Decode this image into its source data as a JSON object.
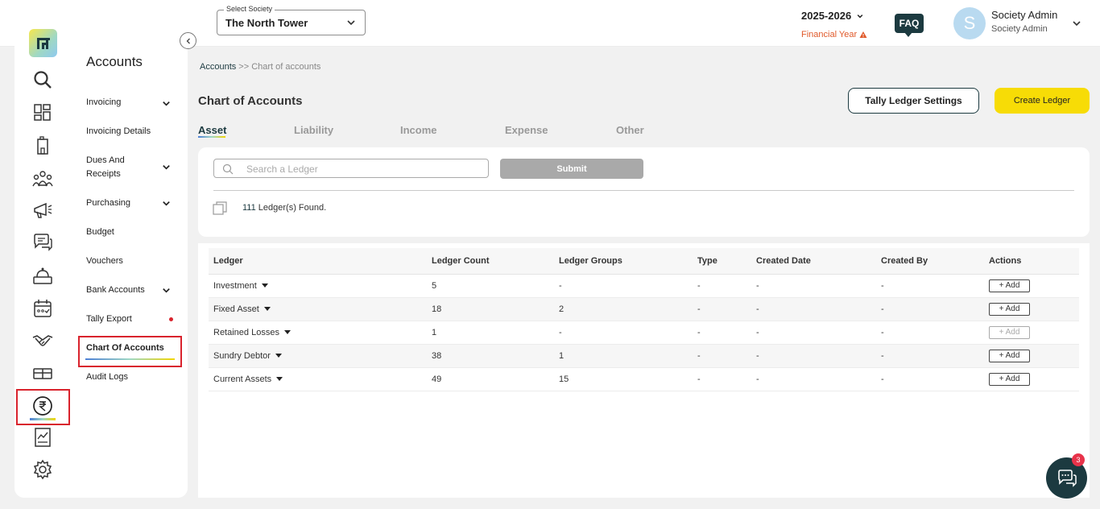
{
  "header": {
    "society_label": "Select Society",
    "society_value": "The North Tower",
    "financial_year": "2025-2026",
    "financial_year_label": "Financial Year",
    "faq_label": "FAQ",
    "avatar_initial": "S",
    "user_name": "Society Admin",
    "user_role": "Society Admin"
  },
  "sidebar": {
    "title": "Accounts",
    "items": [
      {
        "label": "Invoicing"
      },
      {
        "label": "Invoicing Details"
      },
      {
        "label": "Dues And Receipts"
      },
      {
        "label": "Purchasing"
      },
      {
        "label": "Budget"
      },
      {
        "label": "Vouchers"
      },
      {
        "label": "Bank Accounts"
      },
      {
        "label": "Tally Export"
      },
      {
        "label": "Chart Of Accounts"
      },
      {
        "label": "Audit Logs"
      }
    ]
  },
  "breadcrumb": {
    "root": "Accounts",
    "separator": " >> ",
    "current": "Chart of accounts"
  },
  "page": {
    "title": "Chart of Accounts",
    "tally_button": "Tally Ledger Settings",
    "create_button": "Create Ledger",
    "tabs": [
      "Asset",
      "Liability",
      "Income",
      "Expense",
      "Other"
    ],
    "active_tab": "Asset"
  },
  "search": {
    "placeholder": "Search a Ledger",
    "submit_label": "Submit",
    "found_count": "111",
    "found_suffix": " Ledger(s) Found."
  },
  "table": {
    "headers": [
      "Ledger",
      "Ledger Count",
      "Ledger Groups",
      "Type",
      "Created Date",
      "Created By",
      "Actions"
    ],
    "add_label": "+ Add",
    "rows": [
      {
        "ledger": "Investment",
        "count": "5",
        "groups": "-",
        "type": "-",
        "created_date": "-",
        "created_by": "-"
      },
      {
        "ledger": "Fixed Asset",
        "count": "18",
        "groups": "2",
        "type": "-",
        "created_date": "-",
        "created_by": "-"
      },
      {
        "ledger": "Retained Losses",
        "count": "1",
        "groups": "-",
        "type": "-",
        "created_date": "-",
        "created_by": "-"
      },
      {
        "ledger": "Sundry Debtor",
        "count": "38",
        "groups": "1",
        "type": "-",
        "created_date": "-",
        "created_by": "-"
      },
      {
        "ledger": "Current Assets",
        "count": "49",
        "groups": "15",
        "type": "-",
        "created_date": "-",
        "created_by": "-"
      }
    ]
  },
  "chat": {
    "badge_count": "3"
  },
  "colors": {
    "primary": "#1c3a40",
    "accent_yellow": "#f7dc06",
    "highlight_red": "#d9232d",
    "financial_year_orange": "#e0592a"
  },
  "icons": {
    "rail": [
      "logo-icon",
      "search-icon",
      "dashboard-icon",
      "building-icon",
      "members-icon",
      "announcement-icon",
      "chat-icon",
      "helpdesk-icon",
      "calendar-icon",
      "handshake-icon",
      "amenities-icon",
      "rupee-icon",
      "reports-icon",
      "settings-icon"
    ]
  }
}
